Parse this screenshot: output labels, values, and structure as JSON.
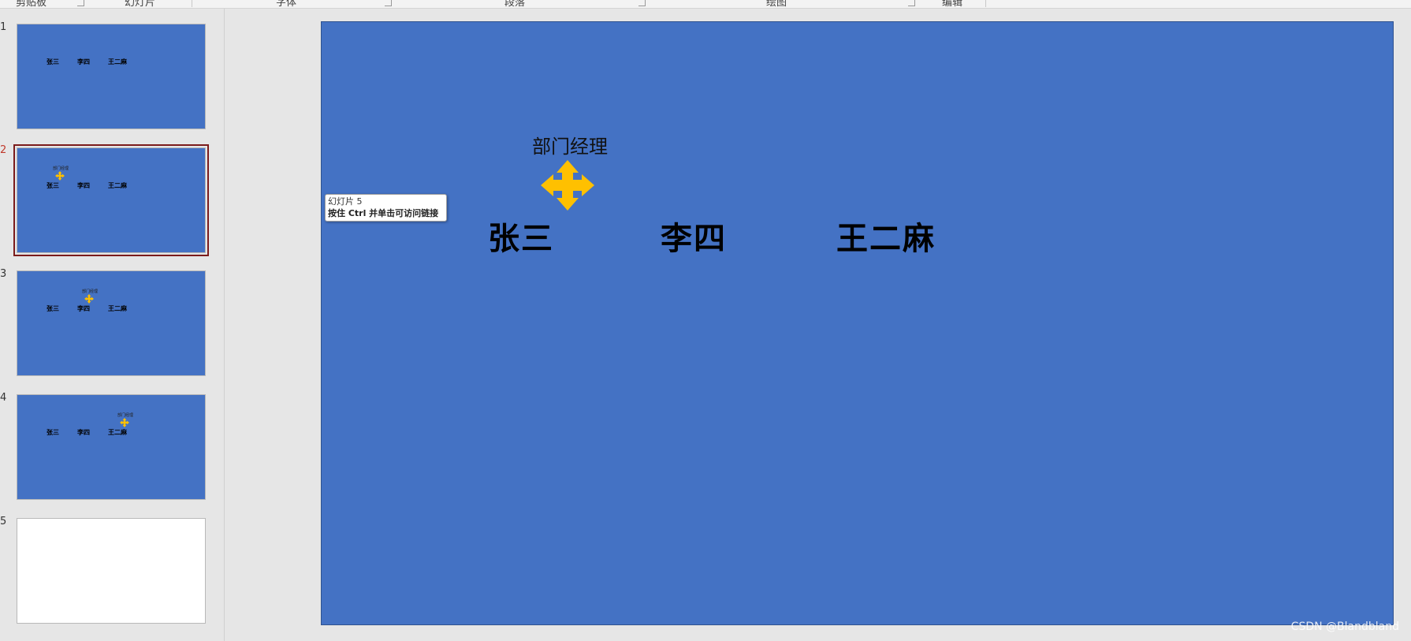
{
  "ribbon": {
    "groups": [
      "剪贴板",
      "幻灯片",
      "字体",
      "段落",
      "绘图",
      "编辑"
    ]
  },
  "thumbnails": [
    {
      "number": "1",
      "names": [
        "张三",
        "李四",
        "王二麻"
      ],
      "star_title": ""
    },
    {
      "number": "2",
      "names": [
        "张三",
        "李四",
        "王二麻"
      ],
      "star_title": "部门经理"
    },
    {
      "number": "3",
      "names": [
        "张三",
        "李四",
        "王二麻"
      ],
      "star_title": "部门经理"
    },
    {
      "number": "4",
      "names": [
        "张三",
        "李四",
        "王二麻"
      ],
      "star_title": "部门经理"
    },
    {
      "number": "5"
    }
  ],
  "selected_slide": "2",
  "slide": {
    "title": "部门经理",
    "names": [
      "张三",
      "李四",
      "王二麻"
    ],
    "background_color": "#4472c4",
    "star_color": "#ffc000",
    "star_icon": "four-way-arrow-icon"
  },
  "tooltip": {
    "line1": "幻灯片 5",
    "line2": "按住 Ctrl 并单击可访问链接"
  },
  "watermark": "CSDN @Blandbland"
}
